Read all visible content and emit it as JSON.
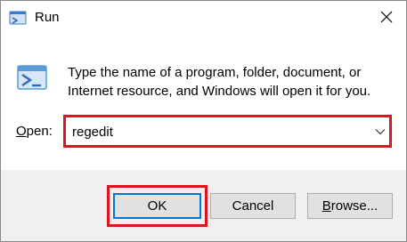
{
  "window": {
    "title": "Run"
  },
  "description": "Type the name of a program, folder, document, or Internet resource, and Windows will open it for you.",
  "open": {
    "label_prefix": "",
    "label_accel": "O",
    "label_rest": "pen:",
    "value": "regedit"
  },
  "buttons": {
    "ok": "OK",
    "cancel": "Cancel",
    "browse_accel": "B",
    "browse_rest": "rowse..."
  },
  "icons": {
    "title": "run-icon",
    "main": "run-icon",
    "close": "close-icon",
    "dropdown": "chevron-down-icon"
  },
  "colors": {
    "highlight": "#e0141e",
    "focus": "#0078d7",
    "footer": "#f0f0f0"
  }
}
